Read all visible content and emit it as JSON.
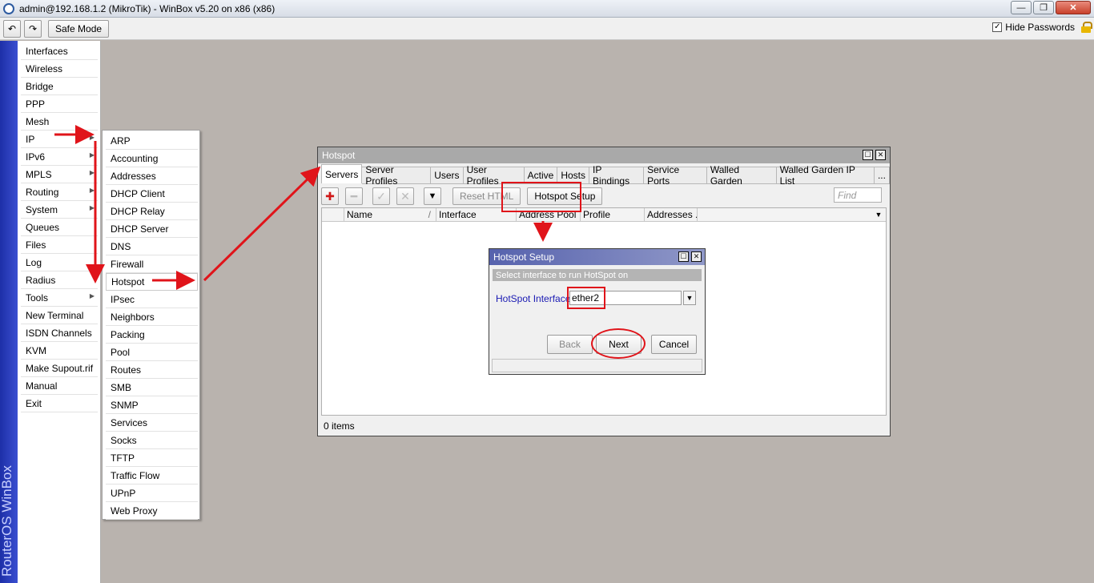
{
  "window": {
    "title": "admin@192.168.1.2 (MikroTik) - WinBox v5.20 on x86 (x86)",
    "min_glyph": "—",
    "max_glyph": "❐",
    "close_glyph": "✕"
  },
  "toolbar": {
    "undo_glyph": "↶",
    "redo_glyph": "↷",
    "safe_mode_label": "Safe Mode",
    "hide_passwords_label": "Hide Passwords",
    "hide_passwords_checked": "✓"
  },
  "brand": {
    "text": "RouterOS WinBox"
  },
  "main_menu": {
    "items": [
      "Interfaces",
      "Wireless",
      "Bridge",
      "PPP",
      "Mesh",
      "IP",
      "IPv6",
      "MPLS",
      "Routing",
      "System",
      "Queues",
      "Files",
      "Log",
      "Radius",
      "Tools",
      "New Terminal",
      "ISDN Channels",
      "KVM",
      "Make Supout.rif",
      "Manual",
      "Exit"
    ],
    "submenu_arrow": "▶"
  },
  "ip_submenu": {
    "items": [
      "ARP",
      "Accounting",
      "Addresses",
      "DHCP Client",
      "DHCP Relay",
      "DHCP Server",
      "DNS",
      "Firewall",
      "Hotspot",
      "IPsec",
      "Neighbors",
      "Packing",
      "Pool",
      "Routes",
      "SMB",
      "SNMP",
      "Services",
      "Socks",
      "TFTP",
      "Traffic Flow",
      "UPnP",
      "Web Proxy"
    ],
    "selected": "Hotspot"
  },
  "hotspot": {
    "title": "Hotspot",
    "tabs": [
      "Servers",
      "Server Profiles",
      "Users",
      "User Profiles",
      "Active",
      "Hosts",
      "IP Bindings",
      "Service Ports",
      "Walled Garden",
      "Walled Garden IP List",
      "..."
    ],
    "active_tab": "Servers",
    "add_glyph": "✚",
    "remove_glyph": "━",
    "enable_glyph": "✓",
    "disable_glyph": "✕",
    "filter_glyph": "▼",
    "reset_html_label": "Reset HTML",
    "hotspot_setup_label": "Hotspot Setup",
    "find_placeholder": "Find",
    "columns": [
      "Name",
      "Interface",
      "Address Pool",
      "Profile",
      "Addresses ..."
    ],
    "sort_glyph": "/",
    "status": "0 items"
  },
  "setup_dialog": {
    "title": "Hotspot Setup",
    "instruction": "Select interface to run HotSpot on",
    "field_label": "HotSpot Interface:",
    "field_value": "ether2",
    "dropdown_glyph": "▼",
    "back_label": "Back",
    "next_label": "Next",
    "cancel_label": "Cancel"
  },
  "colors": {
    "annotation_red": "#e0141a",
    "brand_blue": "#2a3cc0",
    "dialog_title": "#5662ad"
  }
}
